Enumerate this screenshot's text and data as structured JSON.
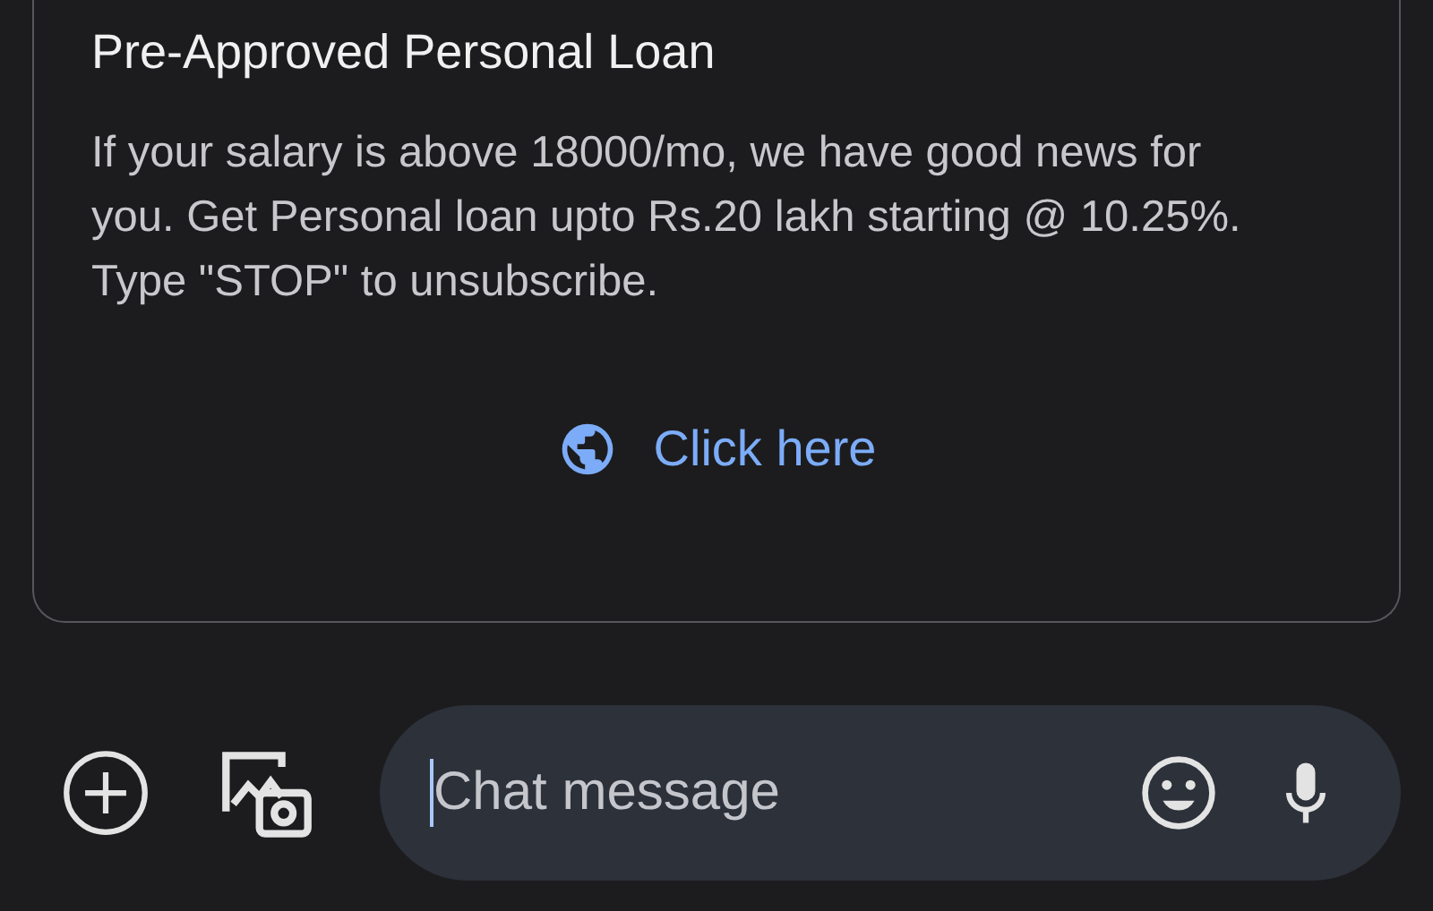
{
  "card": {
    "title": "Pre-Approved Personal Loan",
    "body": "If your salary is above 18000/mo, we have good news for you. Get Personal loan upto Rs.20 lakh starting @ 10.25%.\n Type \"STOP\" to unsubscribe.",
    "link": "Click here"
  },
  "composer": {
    "placeholder": "Chat message"
  }
}
